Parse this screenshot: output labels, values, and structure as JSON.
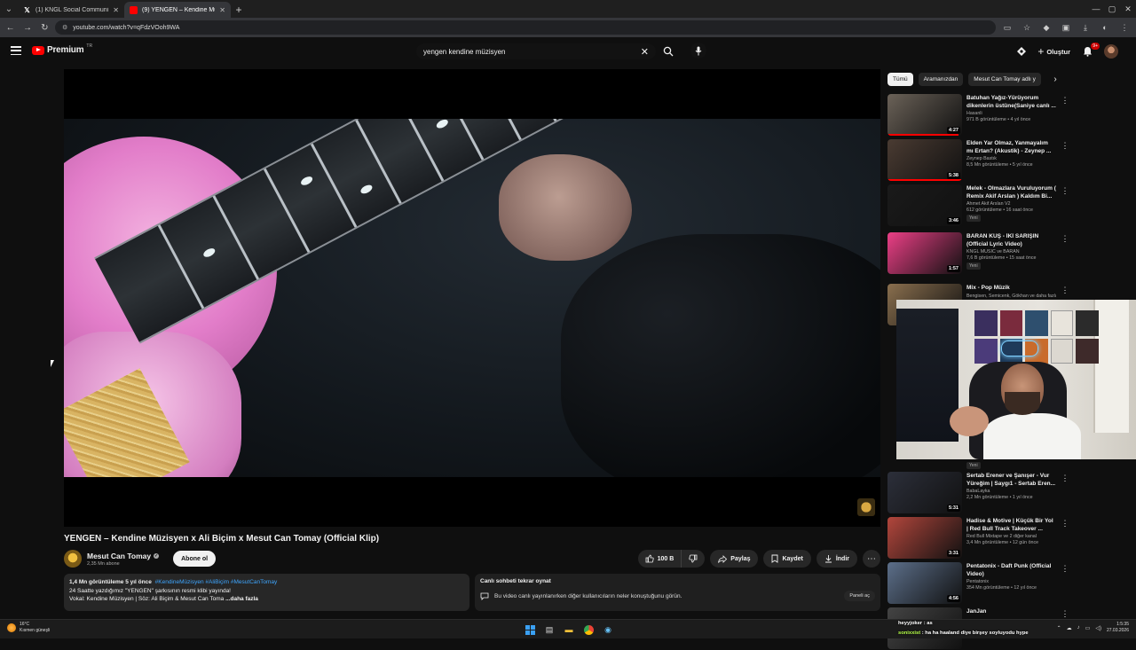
{
  "browser": {
    "tabs": [
      {
        "title": "(1) KNGL Social Community / X",
        "icon": "x-logo-icon",
        "active": false
      },
      {
        "title": "(9) YENGEN – Kendine Müzisyen",
        "icon": "youtube-icon",
        "active": true
      }
    ],
    "url": "youtube.com/watch?v=qFdzVOoh9WA"
  },
  "header": {
    "logo_text": "Premium",
    "logo_country": "TR",
    "search_query": "yengen kendine müzisyen",
    "create_label": "Oluştur",
    "notifications_badge": "9+"
  },
  "video": {
    "title": "YENGEN – Kendine Müzisyen x Ali Biçim x Mesut Can Tomay (Official Klip)",
    "channel": "Mesut Can Tomay",
    "subscribers": "2,35 Mn abone",
    "subscribe_label": "Abone ol",
    "likes": "100 B",
    "share_label": "Paylaş",
    "save_label": "Kaydet",
    "download_label": "İndir"
  },
  "description": {
    "stats": "1,4 Mn görüntüleme  5 yıl önce",
    "tags": "#KendineMüzisyen #AliBiçim #MesutCanTomay",
    "line1": "24 Saatte yazdığımız \"YENGEN\" şarkısının resmi klibi yayında!",
    "line2": "Vokal: Kendine Müzisyen | Söz: Ali Biçim & Mesut Can Toma",
    "more": "...daha fazla"
  },
  "chat_replay": {
    "title": "Canlı sohbeti tekrar oynat",
    "text": "Bu video canlı yayınlanırken diğer kullanıcıların neler konuştuğunu görün.",
    "button": "Paneli aç"
  },
  "sidebar": {
    "chips": [
      "Tümü",
      "Aramanızdan",
      "Mesut Can Tomay adlı y"
    ],
    "recommendations": [
      {
        "title": "Batuhan Yağız-Yürüyorum dikenlerin üstüne(Saniye canlı ...",
        "channel": "Hasanli",
        "stats": "971 B görüntüleme • 4 yıl önce",
        "duration": "4:27",
        "badge": "",
        "thumb_color": "#6b6258",
        "progress": 0.95
      },
      {
        "title": "Elden Yar Olmaz, Yanmayalım mı Ertan? (Akustik) - Zeynep ...",
        "channel": "Zeynep Bastık",
        "stats": "8,5 Mn görüntüleme • 5 yıl önce",
        "duration": "5:38",
        "badge": "",
        "thumb_color": "#4a3b32",
        "progress": 1.0
      },
      {
        "title": "Melek - Olmazlara Vuruluyorum ( Remix Akif Arslan ) Kaldım Bi...",
        "channel": "Ahmet Akif Arslan V2",
        "stats": "612 görüntüleme • 16 saat önce",
        "duration": "3:46",
        "badge": "Yeni",
        "thumb_color": "#1a1a1a",
        "progress": 0
      },
      {
        "title": "BARAN KUŞ - İKİ SARIŞIN (Official Lyric Video)",
        "channel": "KNGL MUSIC ve BARAN",
        "stats": "7,6 B görüntüleme • 15 saat önce",
        "duration": "1:57",
        "badge": "Yeni",
        "thumb_color": "#ec3f86",
        "progress": 0
      },
      {
        "title": "Mix - Pop Müzik",
        "channel": "Bengisen, Semicenk, Gökhan ve daha fazlası",
        "stats": "",
        "duration": "",
        "badge": "",
        "thumb_color": "#8a6f4e",
        "progress": 0
      },
      {
        "title": "Sertab Erener ve Şanışer - Vur Yüreğim | Saygı1 - Sertab Eren...",
        "channel": "BabaLayka",
        "stats": "2,2 Mn görüntüleme • 1 yıl önce",
        "duration": "5:31",
        "badge": "",
        "thumb_color": "#2c2f3a",
        "progress": 0
      },
      {
        "title": "Hadise & Motive | Küçük Bir Yol | Red Bull Track Takeover ...",
        "channel": "Red Bull Mixtape ve 2 diğer kanal",
        "stats": "3,4 Mn görüntüleme • 12 gün önce",
        "duration": "3:31",
        "badge": "",
        "thumb_color": "#b2463c",
        "progress": 0
      },
      {
        "title": "Pentatonix - Daft Punk (Official Video)",
        "channel": "Pentatonix",
        "stats": "354 Mn görüntüleme • 12 yıl önce",
        "duration": "4:56",
        "badge": "",
        "thumb_color": "#5c6f8a",
        "progress": 0
      },
      {
        "title": "JanJan",
        "channel": "",
        "stats": "",
        "duration": "",
        "badge": "",
        "thumb_color": "#444",
        "progress": 0
      }
    ],
    "webcam_badge": "Yeni"
  },
  "taskbar": {
    "temperature": "16°C",
    "weather": "Kısmen güneşli",
    "time": "1:5:35",
    "date": "27.03.2026",
    "chat": [
      {
        "user": "heyyjoker",
        "msg": "as"
      },
      {
        "user": "sonixxist",
        "msg": "ha ha haaland diye birşey soyluyodu hype"
      }
    ]
  },
  "colors": {
    "brand": "#ff0000",
    "background": "#0f0f0f",
    "link": "#3ea6ff",
    "pill": "#272727"
  }
}
